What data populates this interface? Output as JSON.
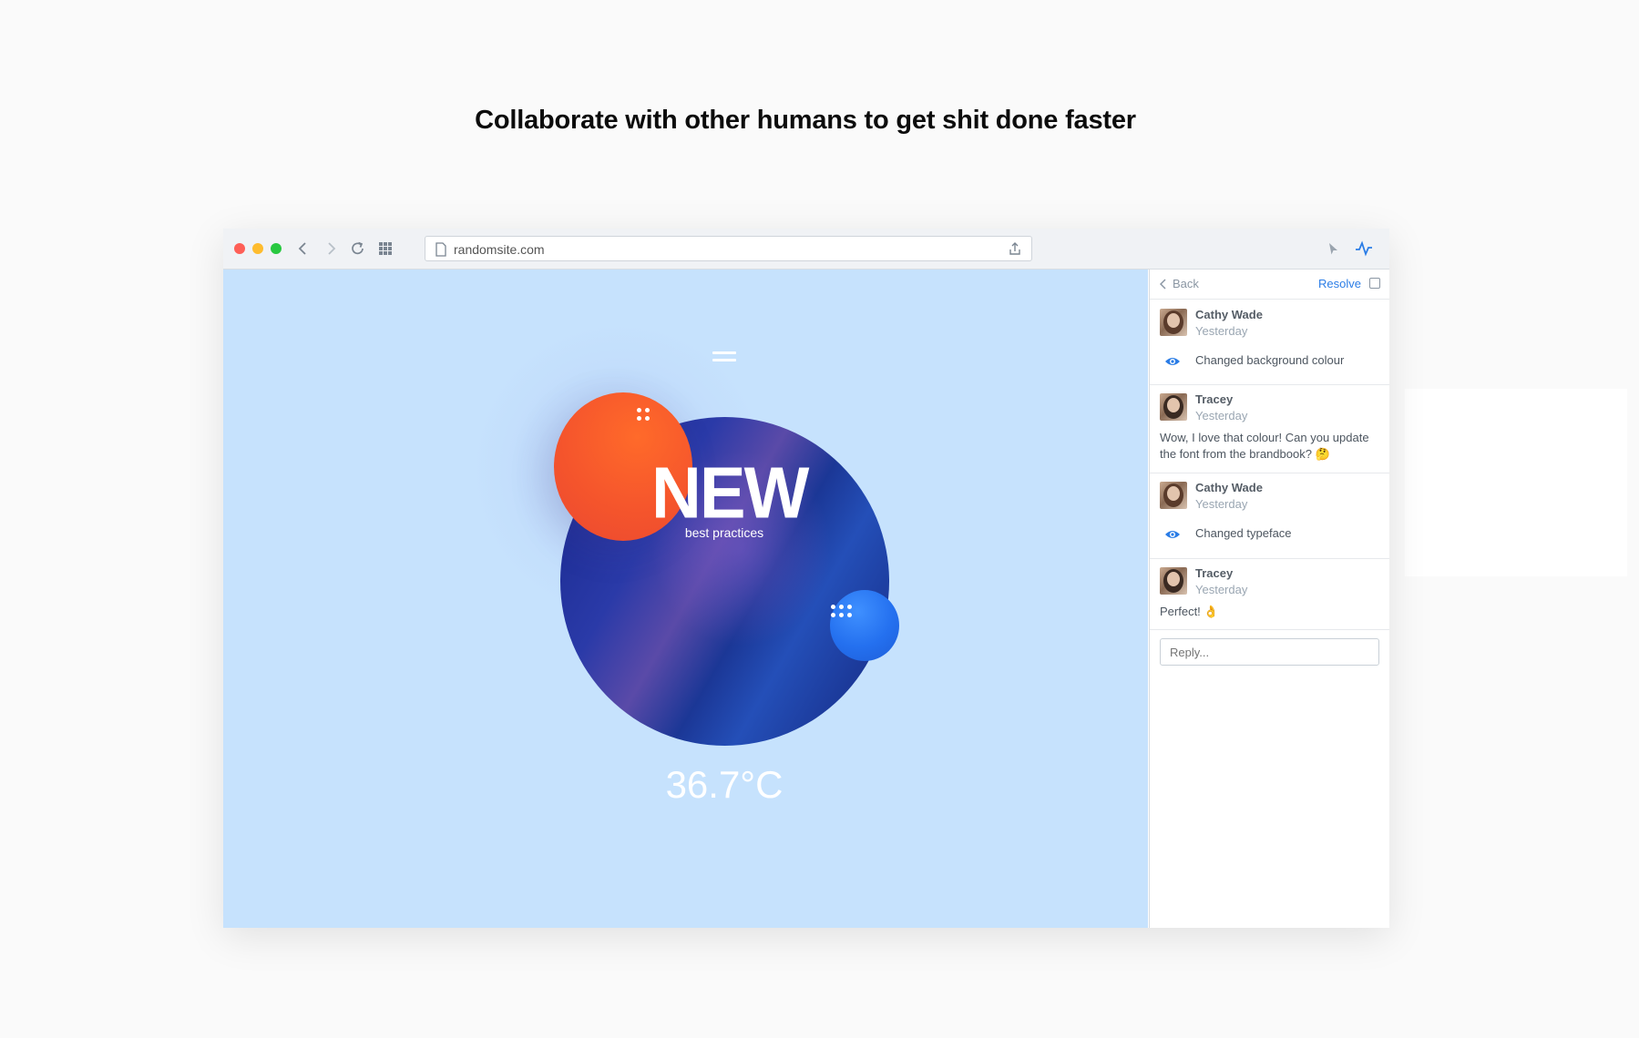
{
  "headline": "Collaborate with other humans to get shit done faster",
  "browser": {
    "url": "randomsite.com",
    "traffic_lights": [
      "#fe5f57",
      "#febc2e",
      "#28c840"
    ],
    "icons": [
      "back-icon",
      "forward-icon",
      "reload-icon",
      "apps-grid-icon",
      "page-icon",
      "share-icon",
      "pointer-icon",
      "activity-icon"
    ]
  },
  "canvas": {
    "background": "#c6e2fd",
    "title": "NEW",
    "subtitle": "best practices",
    "temperature": "36.7°C"
  },
  "sidebar": {
    "back_label": "Back",
    "resolve_label": "Resolve",
    "accent": "#2b7de6",
    "comments": [
      {
        "author": "Cathy Wade",
        "time": "Yesterday",
        "type": "action",
        "text": "Changed background colour"
      },
      {
        "author": "Tracey",
        "time": "Yesterday",
        "type": "message",
        "text": "Wow, I love that colour! Can you update the font from the brandbook? 🤔"
      },
      {
        "author": "Cathy Wade",
        "time": "Yesterday",
        "type": "action",
        "text": "Changed typeface"
      },
      {
        "author": "Tracey",
        "time": "Yesterday",
        "type": "message",
        "text": "Perfect! 👌"
      }
    ],
    "reply_placeholder": "Reply..."
  }
}
